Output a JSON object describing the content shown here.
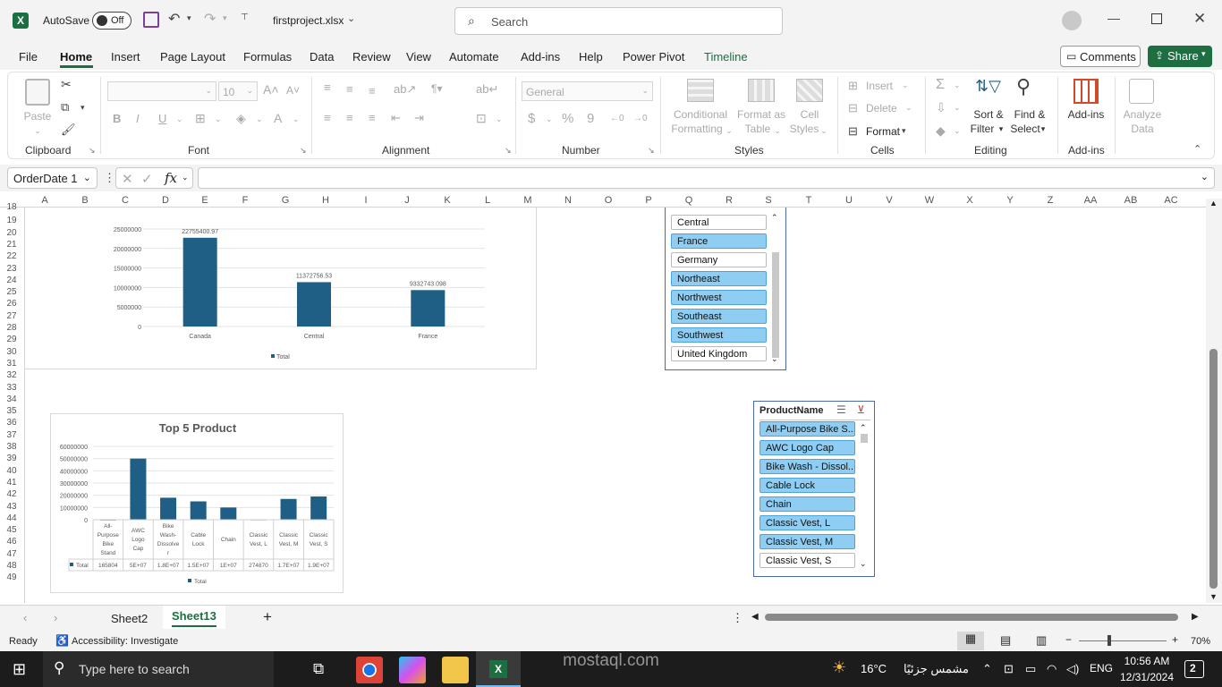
{
  "titlebar": {
    "app_icon": "excel-icon",
    "autosave_label": "AutoSave",
    "autosave_state": "Off",
    "filename": "firstproject.xlsx",
    "search_placeholder": "Search"
  },
  "menu": {
    "tabs": [
      "File",
      "Home",
      "Insert",
      "Page Layout",
      "Formulas",
      "Data",
      "Review",
      "View",
      "Automate",
      "Add-ins",
      "Help",
      "Power Pivot",
      "Timeline"
    ],
    "active": "Home",
    "comments": "Comments",
    "share": "Share"
  },
  "ribbon": {
    "clipboard": {
      "paste": "Paste",
      "group": "Clipboard"
    },
    "font": {
      "name": "",
      "size": "10",
      "group": "Font"
    },
    "alignment": {
      "group": "Alignment"
    },
    "number": {
      "format": "General",
      "group": "Number"
    },
    "styles": {
      "conditional": "Conditional",
      "formatting": "Formatting",
      "format_as": "Format as",
      "table": "Table",
      "cell": "Cell",
      "cell_styles": "Styles",
      "group": "Styles"
    },
    "cells": {
      "insert": "Insert",
      "delete": "Delete",
      "format": "Format",
      "group": "Cells"
    },
    "editing": {
      "sort": "Sort &",
      "filter": "Filter",
      "find": "Find &",
      "select": "Select",
      "group": "Editing"
    },
    "addins": {
      "label": "Add-ins",
      "group": "Add-ins"
    },
    "analyze": {
      "label1": "Analyze",
      "label2": "Data"
    }
  },
  "formula_bar": {
    "name_box": "OrderDate 1",
    "fx": "fx",
    "value": ""
  },
  "columns": [
    "A",
    "B",
    "C",
    "D",
    "E",
    "F",
    "G",
    "H",
    "I",
    "J",
    "K",
    "L",
    "M",
    "N",
    "O",
    "P",
    "Q",
    "R",
    "S",
    "T",
    "U",
    "V",
    "W",
    "X",
    "Y",
    "Z",
    "AA",
    "AB",
    "AC"
  ],
  "rows": [
    "18",
    "19",
    "20",
    "21",
    "22",
    "23",
    "24",
    "25",
    "26",
    "27",
    "28",
    "29",
    "30",
    "31",
    "32",
    "33",
    "34",
    "35",
    "36",
    "37",
    "38",
    "39",
    "40",
    "41",
    "42",
    "43",
    "44",
    "45",
    "46",
    "47",
    "48",
    "49"
  ],
  "chart1": {
    "chart_data": {
      "type": "bar",
      "categories": [
        "Canada",
        "Central",
        "France"
      ],
      "series": [
        {
          "name": "Total",
          "values": [
            22755400.97,
            11372756.53,
            9332743.098
          ]
        }
      ],
      "data_labels": [
        "22755400.97",
        "11372756.53",
        "9332743.098"
      ],
      "yticks": [
        "25000000",
        "20000000",
        "15000000",
        "10000000",
        "5000000",
        "0"
      ],
      "ylim": [
        0,
        25000000
      ],
      "legend": "bottom",
      "color": "#1f5f86"
    }
  },
  "chart2": {
    "chart_data": {
      "type": "bar",
      "title": "Top 5 Product",
      "categories": [
        "All-Purpose Bike Stand",
        "AWC Logo Cap",
        "Bike Wash - Dissolver",
        "Cable Lock",
        "Chain",
        "Classic Vest, L",
        "Classic Vest, M",
        "Classic Vest, S"
      ],
      "category_lines": [
        [
          "All-",
          "Purpose",
          "Bike",
          "Stand"
        ],
        [
          "AWC",
          "Logo",
          "Cap"
        ],
        [
          "Bike",
          "Wash-",
          "Dissolve",
          "r"
        ],
        [
          "Cable",
          "Lock"
        ],
        [
          "Chain"
        ],
        [
          "Classic",
          "Vest, L"
        ],
        [
          "Classic",
          "Vest, M"
        ],
        [
          "Classic",
          "Vest, S"
        ]
      ],
      "series": [
        {
          "name": "Total",
          "values": [
            165804,
            50000000,
            18000000,
            15000000,
            10000000,
            274870,
            17000000,
            19000000
          ]
        }
      ],
      "table_values": [
        "165804",
        "5E+07",
        "1.8E+07",
        "1.5E+07",
        "1E+07",
        "274870",
        "1.7E+07",
        "1.9E+07"
      ],
      "table_row_label": "Total",
      "yticks": [
        "60000000",
        "50000000",
        "40000000",
        "30000000",
        "20000000",
        "10000000",
        "0"
      ],
      "ylim": [
        0,
        60000000
      ],
      "legend": "bottom",
      "color": "#1f5f86"
    }
  },
  "slicer_region": {
    "items": [
      {
        "label": "Central",
        "selected": false
      },
      {
        "label": "France",
        "selected": true
      },
      {
        "label": "Germany",
        "selected": false
      },
      {
        "label": "Northeast",
        "selected": true
      },
      {
        "label": "Northwest",
        "selected": true
      },
      {
        "label": "Southeast",
        "selected": true
      },
      {
        "label": "Southwest",
        "selected": true
      },
      {
        "label": "United Kingdom",
        "selected": false
      }
    ]
  },
  "slicer_product": {
    "title": "ProductName",
    "items": [
      {
        "label": "All-Purpose Bike S...",
        "selected": true
      },
      {
        "label": "AWC Logo Cap",
        "selected": true
      },
      {
        "label": "Bike Wash - Dissol...",
        "selected": true
      },
      {
        "label": "Cable Lock",
        "selected": true
      },
      {
        "label": "Chain",
        "selected": true
      },
      {
        "label": "Classic Vest, L",
        "selected": true
      },
      {
        "label": "Classic Vest, M",
        "selected": true
      },
      {
        "label": "Classic Vest, S",
        "selected": false
      }
    ]
  },
  "sheets": {
    "tabs": [
      "Sheet2",
      "Sheet13"
    ],
    "active": "Sheet13",
    "add": "+"
  },
  "status": {
    "ready": "Ready",
    "accessibility": "Accessibility: Investigate",
    "zoom": "70%"
  },
  "taskbar": {
    "search_placeholder": "Type here to search",
    "weather": "16°C",
    "weather_text": "مشمس جزئيًا",
    "lang": "ENG",
    "time": "10:56 AM",
    "date": "12/31/2024",
    "notif": "2"
  },
  "watermark": {
    "text": "mostaql.com"
  }
}
